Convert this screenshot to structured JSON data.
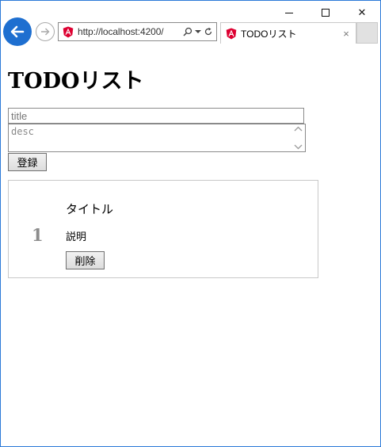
{
  "browser": {
    "url": "http://localhost:4200/",
    "tab_title": "TODOリスト",
    "tab_close": "×",
    "caption": {
      "close": "✕"
    }
  },
  "page": {
    "heading": "TODOリスト",
    "form": {
      "title_placeholder": "title",
      "desc_placeholder": "desc",
      "register_label": "登録"
    },
    "todos": [
      {
        "number": "1",
        "title": "タイトル",
        "desc": "説明",
        "delete_label": "削除"
      }
    ]
  },
  "colors": {
    "back_button": "#1e6fd0",
    "angular_red": "#dd0031",
    "window_border": "#2b79d8"
  }
}
